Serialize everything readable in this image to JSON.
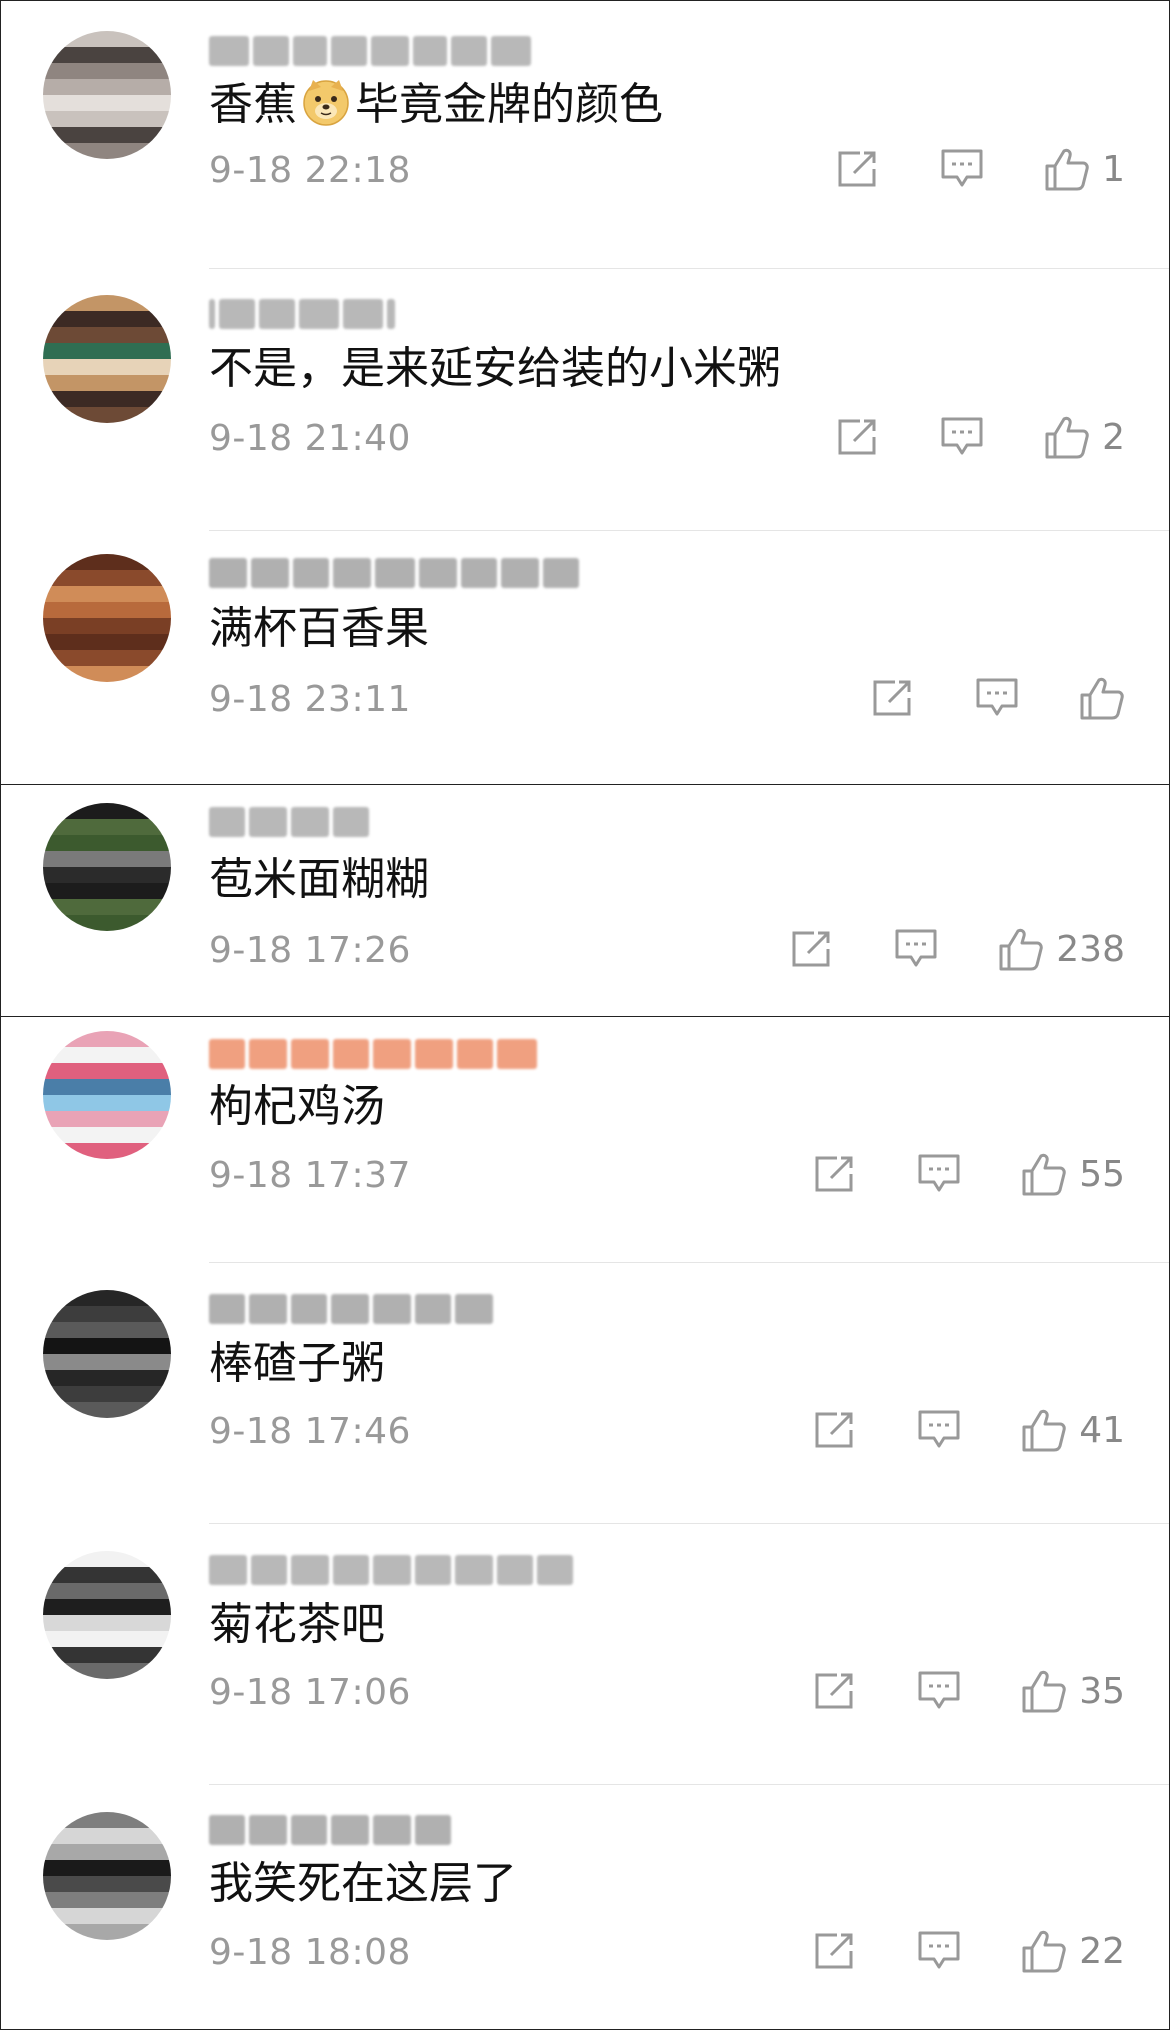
{
  "comments": [
    {
      "text_before": "香蕉",
      "emoji": "doge-emoji",
      "text_after": "毕竟金牌的颜色",
      "time": "9-18 22:18",
      "likes": "1",
      "avatar_colors": [
        "#c9c2bd",
        "#8f8580",
        "#e4dfdb",
        "#4a4340",
        "#b6ada8"
      ],
      "username_color": "#b8b8b8"
    },
    {
      "text": "不是，是来延安给装的小米粥",
      "time": "9-18 21:40",
      "likes": "2",
      "avatar_colors": [
        "#2f6e52",
        "#c39566",
        "#6d4a36",
        "#e7d3b8",
        "#3c2a24"
      ],
      "username_color": "#b8b8b8"
    },
    {
      "text": "满杯百香果",
      "time": "9-18 23:11",
      "likes": "",
      "avatar_colors": [
        "#8a4a2c",
        "#b86a3c",
        "#5e2e1c",
        "#d08c58",
        "#7a3f25"
      ],
      "username_color": "#b0b0b0"
    },
    {
      "text": "苞米面糊糊",
      "time": "9-18 17:26",
      "likes": "238",
      "avatar_colors": [
        "#2b2b2b",
        "#4f6a3c",
        "#7a7a7a",
        "#1c1c1c",
        "#3c5a2e"
      ],
      "username_color": "#b8b8b8"
    },
    {
      "text": "枸杞鸡汤",
      "time": "9-18 17:37",
      "likes": "55",
      "avatar_colors": [
        "#e0607e",
        "#8fc7e6",
        "#f3f3f3",
        "#4a7ea8",
        "#e9a3b6"
      ],
      "username_color": "#f0a080"
    },
    {
      "text": "棒碴子粥",
      "time": "9-18 17:46",
      "likes": "41",
      "avatar_colors": [
        "#262626",
        "#5a5a5a",
        "#8a8a8a",
        "#3d3d3d",
        "#141414"
      ],
      "username_color": "#b0b0b0"
    },
    {
      "text": "菊花茶吧",
      "time": "9-18 17:06",
      "likes": "35",
      "avatar_colors": [
        "#1e1e1e",
        "#f2f2f2",
        "#6a6a6a",
        "#d8d8d8",
        "#343434"
      ],
      "username_color": "#b8b8b8"
    },
    {
      "text": "我笑死在这层了",
      "time": "9-18 18:08",
      "likes": "22",
      "avatar_colors": [
        "#d6d6d6",
        "#1a1a1a",
        "#7e7e7e",
        "#a8a8a8",
        "#4a4a4a"
      ],
      "username_color": "#b0b0b0"
    }
  ],
  "icons": {
    "share": "share-icon",
    "reply": "comment-icon",
    "like": "thumbs-up-icon"
  }
}
